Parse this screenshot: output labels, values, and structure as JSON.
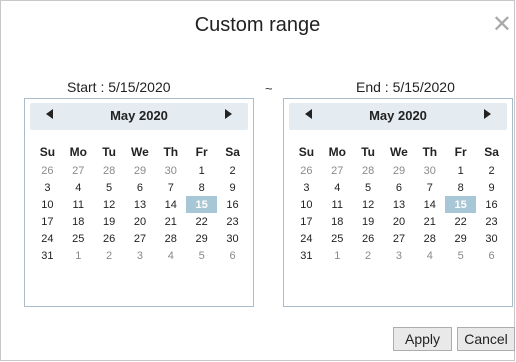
{
  "dialog": {
    "title": "Custom range",
    "close_glyph": "✕"
  },
  "start": {
    "label": "Start : 5/15/2020",
    "month_label": "May 2020"
  },
  "separator": "~",
  "end": {
    "label": "End : 5/15/2020",
    "month_label": "May 2020"
  },
  "weekdays": [
    "Su",
    "Mo",
    "Tu",
    "We",
    "Th",
    "Fr",
    "Sa"
  ],
  "days": [
    [
      "26",
      "27",
      "28",
      "29",
      "30",
      "1",
      "2"
    ],
    [
      "3",
      "4",
      "5",
      "6",
      "7",
      "8",
      "9"
    ],
    [
      "10",
      "11",
      "12",
      "13",
      "14",
      "15",
      "16"
    ],
    [
      "17",
      "18",
      "19",
      "20",
      "21",
      "22",
      "23"
    ],
    [
      "24",
      "25",
      "26",
      "27",
      "28",
      "29",
      "30"
    ],
    [
      "31",
      "1",
      "2",
      "3",
      "4",
      "5",
      "6"
    ]
  ],
  "selected_day": "15",
  "buttons": {
    "apply": "Apply",
    "cancel": "Cancel"
  },
  "colors": {
    "selected_bg": "#a7c6d6",
    "header_bg": "#e4ebf1",
    "other_month_text": "#8a8a8a"
  }
}
